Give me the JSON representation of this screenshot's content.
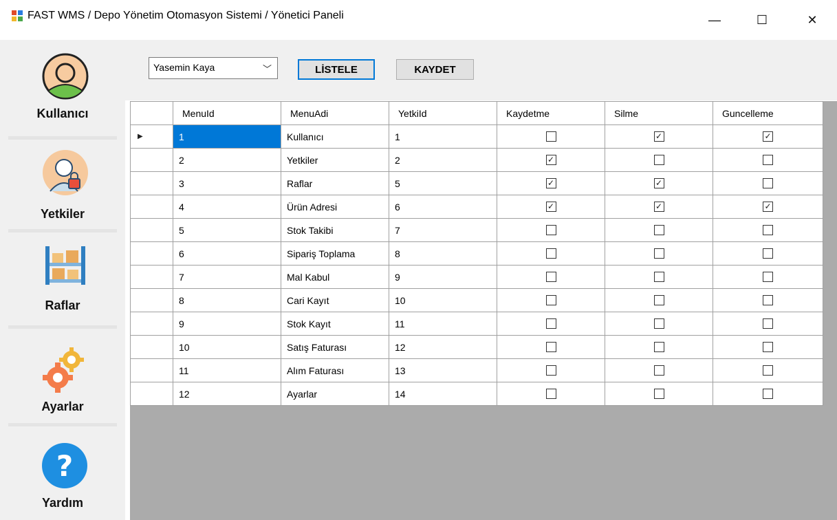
{
  "window": {
    "title": "FAST WMS / Depo Yönetim Otomasyon Sistemi / Yönetici Paneli",
    "minimize": "—",
    "maximize": "☐",
    "close": "✕"
  },
  "sidebar": {
    "items": [
      {
        "label": "Kullanıcı",
        "icon": "user-avatar-icon"
      },
      {
        "label": "Yetkiler",
        "icon": "user-lock-icon"
      },
      {
        "label": "Raflar",
        "icon": "shelf-boxes-icon"
      },
      {
        "label": "Ayarlar",
        "icon": "gears-icon"
      },
      {
        "label": "Yardım",
        "icon": "help-question-icon"
      }
    ]
  },
  "toolbar": {
    "user_select_value": "Yasemin Kaya",
    "list_label": "LİSTELE",
    "save_label": "KAYDET"
  },
  "grid": {
    "columns": [
      "MenuId",
      "MenuAdi",
      "YetkiId",
      "Kaydetme",
      "Silme",
      "Guncelleme"
    ],
    "selected_row_indicator": "▶",
    "rows": [
      {
        "MenuId": "1",
        "MenuAdi": "Kullanıcı",
        "YetkiId": "1",
        "Kaydetme": false,
        "Silme": true,
        "Guncelleme": true
      },
      {
        "MenuId": "2",
        "MenuAdi": "Yetkiler",
        "YetkiId": "2",
        "Kaydetme": true,
        "Silme": false,
        "Guncelleme": false
      },
      {
        "MenuId": "3",
        "MenuAdi": "Raflar",
        "YetkiId": "5",
        "Kaydetme": true,
        "Silme": true,
        "Guncelleme": false
      },
      {
        "MenuId": "4",
        "MenuAdi": "Ürün Adresi",
        "YetkiId": "6",
        "Kaydetme": true,
        "Silme": true,
        "Guncelleme": true
      },
      {
        "MenuId": "5",
        "MenuAdi": "Stok Takibi",
        "YetkiId": "7",
        "Kaydetme": false,
        "Silme": false,
        "Guncelleme": false
      },
      {
        "MenuId": "6",
        "MenuAdi": "Sipariş Toplama",
        "YetkiId": "8",
        "Kaydetme": false,
        "Silme": false,
        "Guncelleme": false
      },
      {
        "MenuId": "7",
        "MenuAdi": "Mal Kabul",
        "YetkiId": "9",
        "Kaydetme": false,
        "Silme": false,
        "Guncelleme": false
      },
      {
        "MenuId": "8",
        "MenuAdi": "Cari Kayıt",
        "YetkiId": "10",
        "Kaydetme": false,
        "Silme": false,
        "Guncelleme": false
      },
      {
        "MenuId": "9",
        "MenuAdi": "Stok Kayıt",
        "YetkiId": "11",
        "Kaydetme": false,
        "Silme": false,
        "Guncelleme": false
      },
      {
        "MenuId": "10",
        "MenuAdi": "Satış Faturası",
        "YetkiId": "12",
        "Kaydetme": false,
        "Silme": false,
        "Guncelleme": false
      },
      {
        "MenuId": "11",
        "MenuAdi": "Alım Faturası",
        "YetkiId": "13",
        "Kaydetme": false,
        "Silme": false,
        "Guncelleme": false
      },
      {
        "MenuId": "12",
        "MenuAdi": "Ayarlar",
        "YetkiId": "14",
        "Kaydetme": false,
        "Silme": false,
        "Guncelleme": false
      }
    ]
  },
  "colors": {
    "accent": "#0078d7",
    "panel_bg": "#f0f0f0",
    "grid_empty_bg": "#ababab"
  }
}
